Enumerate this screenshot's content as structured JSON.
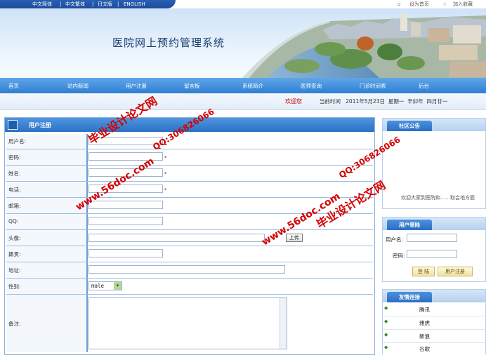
{
  "topbar": {
    "languages": [
      "中文简体",
      "中文繁体",
      "日文版",
      "ENGLISH"
    ],
    "separators": [
      "|",
      "|",
      "|"
    ],
    "set_home": "设为首页",
    "add_favorite": "加入收藏"
  },
  "banner": {
    "title": "医院网上预约管理系统"
  },
  "nav": {
    "items": [
      "首页",
      "站内新闻",
      "用户注册",
      "留言板",
      "系统简介",
      "医师查询",
      "门诊时间表",
      "后台"
    ]
  },
  "subbar": {
    "welcome": "欢迎您",
    "date_text": "当前时间   2011年5月23日  星期一  辛卯年  四月廿一"
  },
  "form": {
    "title": "用户注册",
    "fields": {
      "username": "用户名:",
      "password": "密码:",
      "name": "姓名:",
      "phone": "电话:",
      "email": "邮箱:",
      "qq": "QQ:",
      "avatar": "头像:",
      "hometown": "籍贯:",
      "address": "地址:",
      "gender": "性别:",
      "remarks": "备注:"
    },
    "required_mark": "*",
    "upload_label": "上传",
    "gender_value": "male"
  },
  "sidebar": {
    "notice_title": "社区公告",
    "notice_text": "欢迎大家到医院和……取会地方面",
    "login_title": "用户登陆",
    "login_user_label": "用户名:",
    "login_pass_label": "密码:",
    "login_button": "登 陆",
    "register_button": "用户注册",
    "links_title": "友情连接",
    "links": [
      "腾讯",
      "雅虎",
      "新浪",
      "谷歌"
    ]
  },
  "watermarks": {
    "title": "毕业设计论文网",
    "site": "www.56doc.com",
    "qq": "QQ:306826066"
  },
  "colors": {
    "accent": "#2f7fd4",
    "watermark": "#d50000",
    "welcome": "#c00000"
  }
}
